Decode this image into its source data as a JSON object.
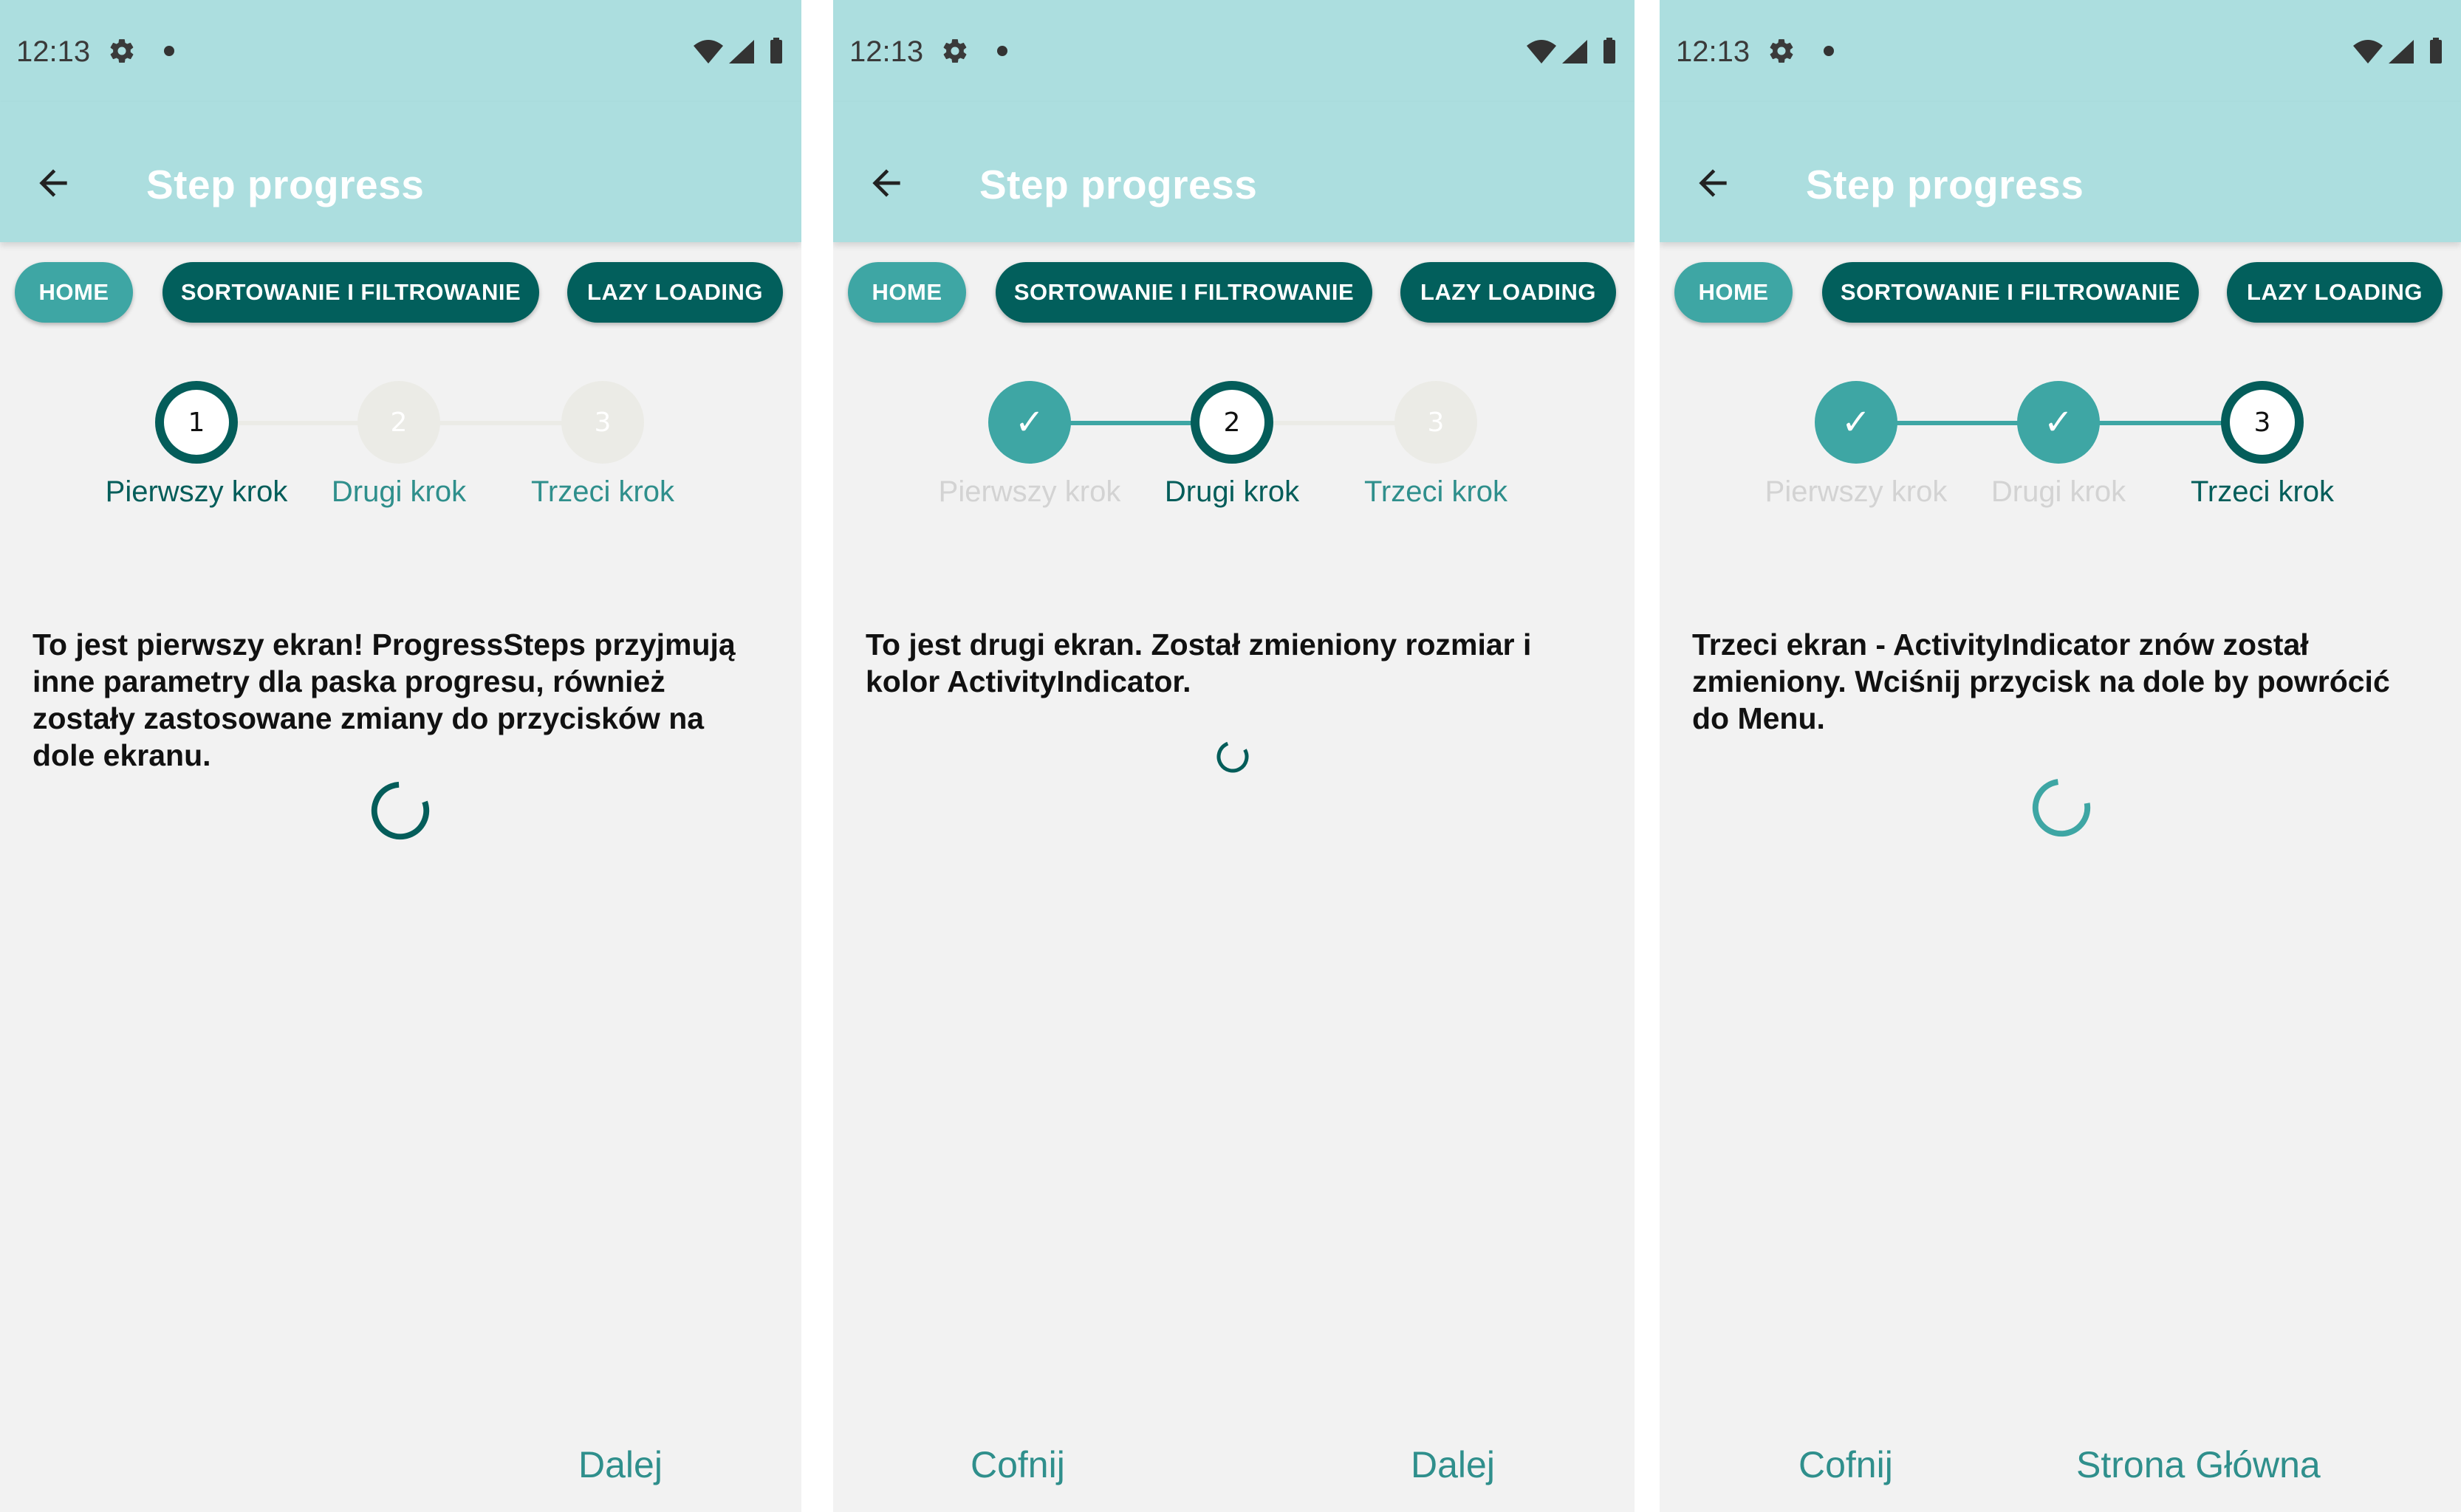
{
  "colors": {
    "header_bg": "#acdedf",
    "home_button": "#3ea6a4",
    "nav_button": "#025f5c",
    "step_active": "#045d5a",
    "step_done": "#3ea6a4",
    "step_todo": "#ebebe6",
    "footer_link": "#2f8f8c"
  },
  "screens": [
    {
      "status": {
        "time": "12:13",
        "icons": [
          "settings-icon",
          "dot-icon",
          "wifi-icon",
          "signal-icon",
          "battery-icon"
        ]
      },
      "header": {
        "back_icon": "arrow-left-icon",
        "title": "Step progress"
      },
      "nav": {
        "home": "HOME",
        "sort": "SORTOWANIE I FILTROWANIE",
        "lazy": "LAZY LOADING"
      },
      "steps": [
        {
          "marker": "1",
          "label": "Pierwszy krok",
          "state": "active"
        },
        {
          "marker": "2",
          "label": "Drugi krok",
          "state": "todo"
        },
        {
          "marker": "3",
          "label": "Trzeci krok",
          "state": "todo"
        }
      ],
      "message": "To jest pierwszy ekran! ProgressSteps przyjmują inne parametry dla paska progresu, również zostały zastosowane zmiany do przycisków na dole ekranu.",
      "spinner_color": "#045d5a",
      "footer": {
        "previous": "",
        "next": "Dalej"
      }
    },
    {
      "status": {
        "time": "12:13",
        "icons": [
          "settings-icon",
          "dot-icon",
          "wifi-icon",
          "signal-icon",
          "battery-icon"
        ]
      },
      "header": {
        "back_icon": "arrow-left-icon",
        "title": "Step progress"
      },
      "nav": {
        "home": "HOME",
        "sort": "SORTOWANIE I FILTROWANIE",
        "lazy": "LAZY LOADING"
      },
      "steps": [
        {
          "marker": "✓",
          "label": "Pierwszy krok",
          "state": "done"
        },
        {
          "marker": "2",
          "label": "Drugi krok",
          "state": "active"
        },
        {
          "marker": "3",
          "label": "Trzeci krok",
          "state": "todo"
        }
      ],
      "message": "To jest drugi ekran. Został zmieniony rozmiar i kolor ActivityIndicator.",
      "spinner_color": "#045d5a",
      "footer": {
        "previous": "Cofnij",
        "next": "Dalej"
      }
    },
    {
      "status": {
        "time": "12:13",
        "icons": [
          "settings-icon",
          "dot-icon",
          "wifi-icon",
          "signal-icon",
          "battery-icon"
        ]
      },
      "header": {
        "back_icon": "arrow-left-icon",
        "title": "Step progress"
      },
      "nav": {
        "home": "HOME",
        "sort": "SORTOWANIE I FILTROWANIE",
        "lazy": "LAZY LOADING"
      },
      "steps": [
        {
          "marker": "✓",
          "label": "Pierwszy krok",
          "state": "done"
        },
        {
          "marker": "✓",
          "label": "Drugi krok",
          "state": "done"
        },
        {
          "marker": "3",
          "label": "Trzeci krok",
          "state": "active"
        }
      ],
      "message": "Trzeci ekran - ActivityIndicator znów został zmieniony. Wciśnij przycisk na dole by powrócić do Menu.",
      "spinner_color": "#3ea6a4",
      "footer": {
        "previous": "Cofnij",
        "next": "Strona Główna"
      }
    }
  ]
}
